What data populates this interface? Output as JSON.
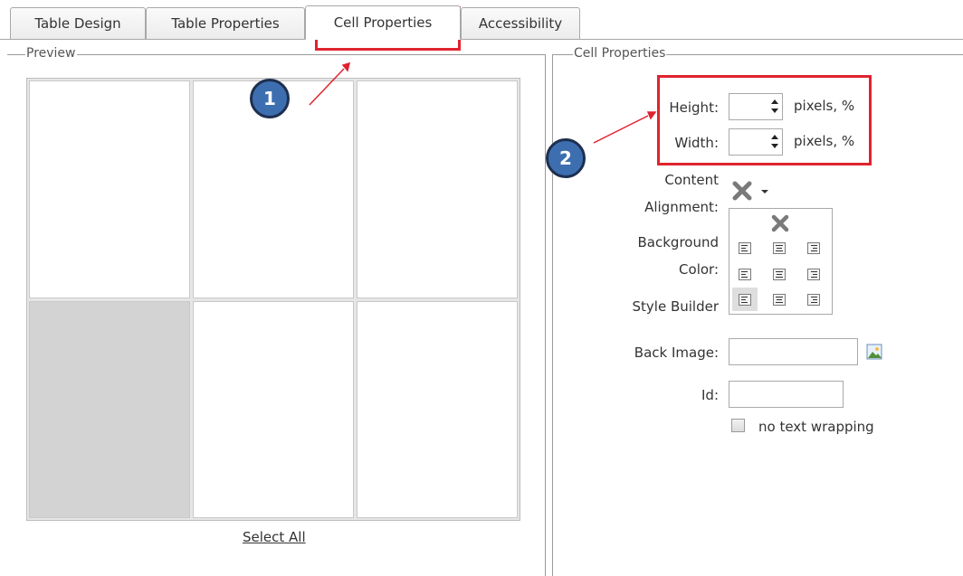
{
  "tabs": [
    {
      "label": "Table Design"
    },
    {
      "label": "Table Properties"
    },
    {
      "label": "Cell Properties"
    },
    {
      "label": "Accessibility"
    }
  ],
  "preview": {
    "legend": "Preview",
    "select_all_label": "Select All"
  },
  "cell_properties": {
    "legend": "Cell Properties",
    "height": {
      "label": "Height:",
      "value": "",
      "unit": "pixels, %"
    },
    "width": {
      "label": "Width:",
      "value": "",
      "unit": "pixels, %"
    },
    "content_alignment": {
      "label_line1": "Content",
      "label_line2": "Alignment:"
    },
    "background_color": {
      "label_line1": "Background",
      "label_line2": "Color:"
    },
    "style_builder": {
      "label": "Style Builder"
    },
    "back_image": {
      "label": "Back Image:",
      "value": ""
    },
    "id": {
      "label": "Id:",
      "value": ""
    },
    "no_text_wrapping": {
      "label": "no text wrapping",
      "checked": false
    }
  },
  "annotations": {
    "marker_1": "1",
    "marker_2": "2",
    "highlight_color": "#e0232e",
    "marker_color": "#3d6fb0"
  }
}
